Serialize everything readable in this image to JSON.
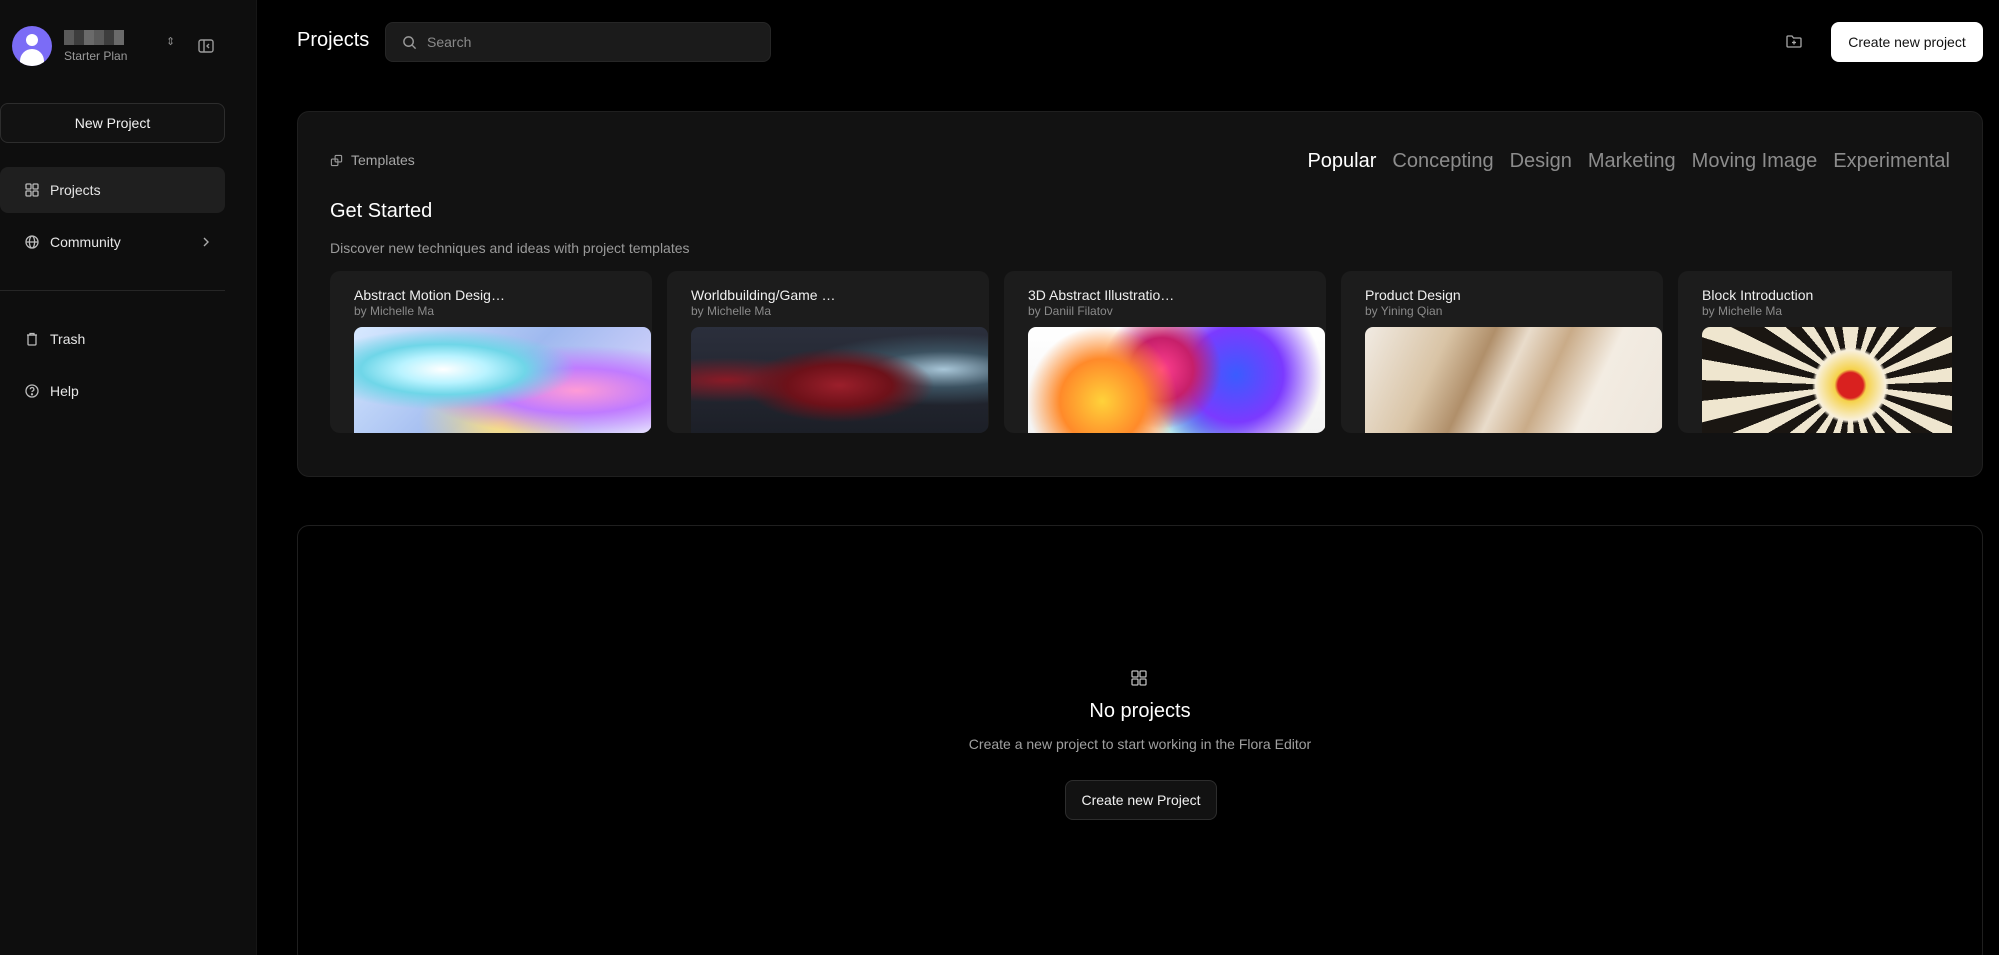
{
  "sidebar": {
    "account": {
      "plan": "Starter Plan",
      "switch_glyph": "⇕"
    },
    "new_project_label": "New Project",
    "items": [
      {
        "label": "Projects",
        "icon": "grid-icon",
        "active": true
      },
      {
        "label": "Community",
        "icon": "globe-icon"
      },
      {
        "label": "Trash",
        "icon": "trash-icon"
      },
      {
        "label": "Help",
        "icon": "help-circle-icon"
      }
    ]
  },
  "header": {
    "title": "Projects",
    "search_placeholder": "Search",
    "create_label": "Create new project"
  },
  "templates": {
    "label": "Templates",
    "tabs": [
      "Popular",
      "Concepting",
      "Design",
      "Marketing",
      "Moving Image",
      "Experimental"
    ],
    "active_tab": "Popular",
    "heading": "Get Started",
    "description": "Discover new techniques and ideas with project templates",
    "cards": [
      {
        "title": "Abstract Motion Desig…",
        "author": "by Michelle Ma"
      },
      {
        "title": "Worldbuilding/Game …",
        "author": "by Michelle Ma"
      },
      {
        "title": "3D Abstract Illustratio…",
        "author": "by Daniil Filatov"
      },
      {
        "title": "Product Design",
        "author": "by Yining Qian"
      },
      {
        "title": "Block Introduction",
        "author": "by Michelle Ma"
      }
    ]
  },
  "empty_state": {
    "title": "No projects",
    "description": "Create a new project to start working in the Flora Editor",
    "button_label": "Create new Project"
  },
  "colors": {
    "background": "#000000",
    "sidebar": "#0e0e0e",
    "panel": "#121212",
    "avatar": "#7b6cf6",
    "primary_button": "#ffffff"
  }
}
